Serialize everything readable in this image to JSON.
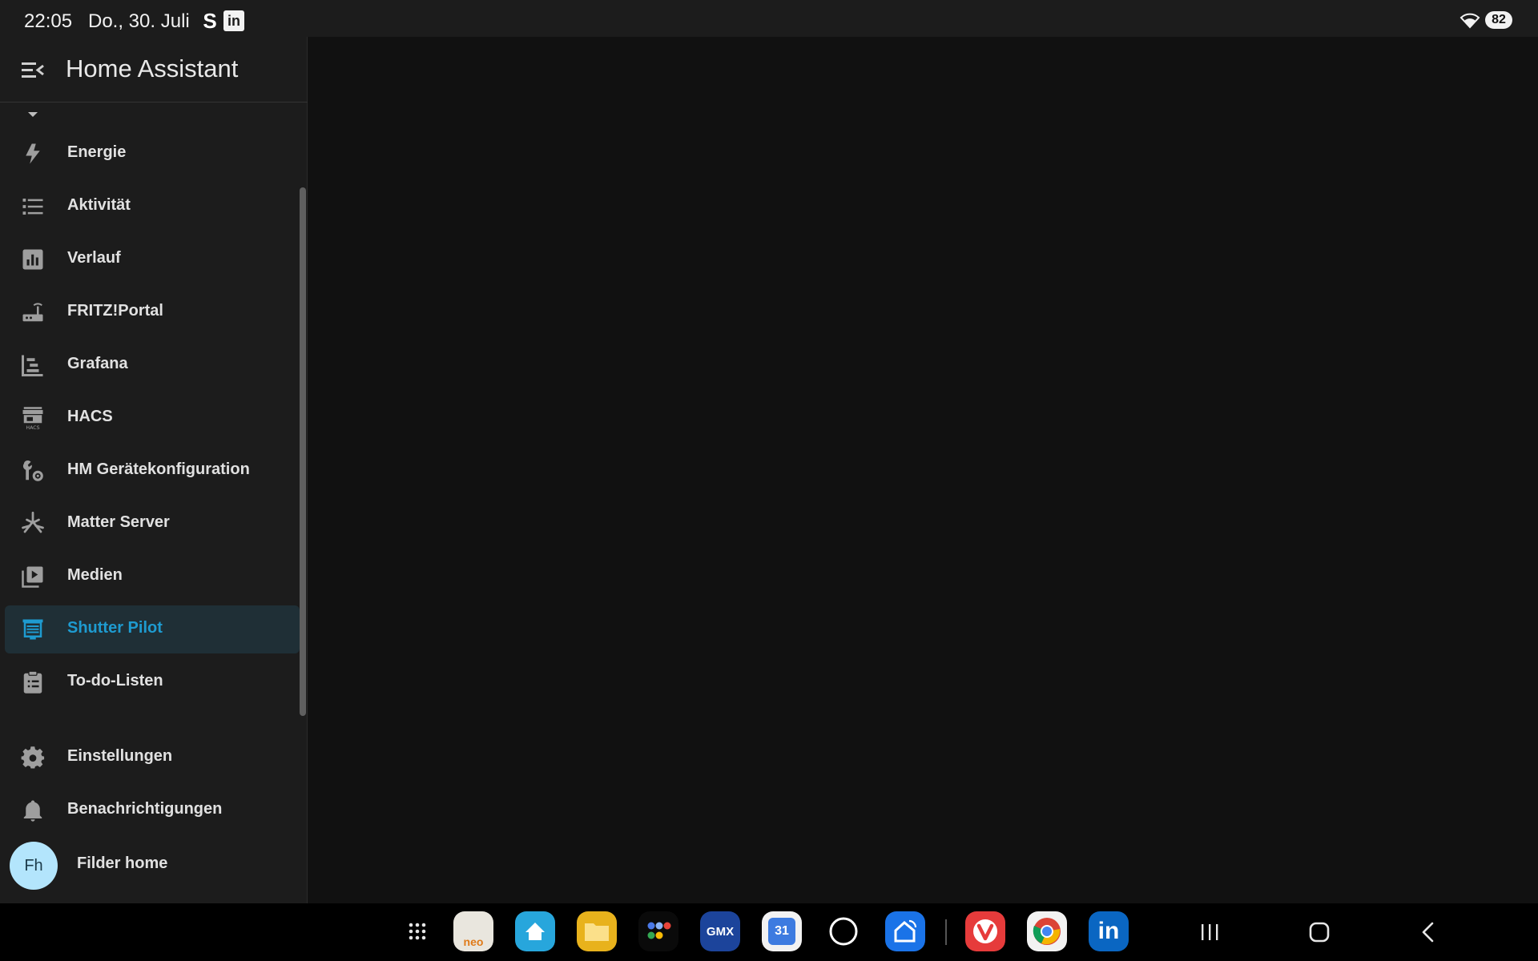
{
  "status_bar": {
    "time": "22:05",
    "date": "Do., 30. Juli",
    "notif_icons": [
      "s-app-icon",
      "linkedin-icon"
    ],
    "battery": "82"
  },
  "sidebar": {
    "title": "Home Assistant",
    "items": [
      {
        "label": "Energie",
        "icon": "lightning-icon"
      },
      {
        "label": "Aktivität",
        "icon": "list-icon"
      },
      {
        "label": "Verlauf",
        "icon": "chart-box-icon"
      },
      {
        "label": "FRITZ!Portal",
        "icon": "router-icon"
      },
      {
        "label": "Grafana",
        "icon": "chart-gantt-icon"
      },
      {
        "label": "HACS",
        "icon": "hacs-icon"
      },
      {
        "label": "HM Gerätekonfiguration",
        "icon": "wrench-cog-icon"
      },
      {
        "label": "Matter Server",
        "icon": "matter-icon"
      },
      {
        "label": "Medien",
        "icon": "play-box-multiple-icon"
      },
      {
        "label": "Shutter Pilot",
        "icon": "shutter-icon",
        "active": true
      },
      {
        "label": "To-do-Listen",
        "icon": "clipboard-list-icon"
      }
    ],
    "bottom_items": [
      {
        "label": "Einstellungen",
        "icon": "gear-icon"
      },
      {
        "label": "Benachrichtigungen",
        "icon": "bell-icon"
      }
    ],
    "user": {
      "initials": "Fh",
      "name": "Filder home"
    },
    "accent_color": "#1e9bd0"
  },
  "taskbar": {
    "apps": [
      {
        "name": "neo-app-icon",
        "label": "neo"
      },
      {
        "name": "home-assistant-app-icon",
        "label": ""
      },
      {
        "name": "files-app-icon",
        "label": ""
      },
      {
        "name": "app-folder-icon",
        "label": ""
      },
      {
        "name": "gmx-app-icon",
        "label": "GMX"
      },
      {
        "name": "calendar-app-icon",
        "label": "31"
      },
      {
        "name": "circle-app-icon",
        "label": ""
      },
      {
        "name": "smartthings-app-icon",
        "label": ""
      },
      {
        "name": "vivaldi-app-icon",
        "label": ""
      },
      {
        "name": "chrome-app-icon",
        "label": ""
      },
      {
        "name": "linkedin-app-icon",
        "label": "in"
      }
    ]
  }
}
